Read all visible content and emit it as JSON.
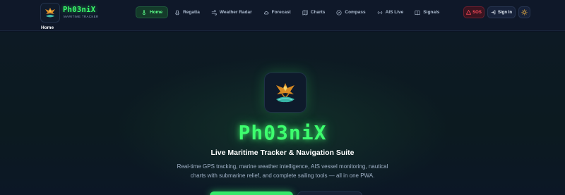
{
  "brand": {
    "name": "Ph03niX",
    "tagline": "MARITIME TRACKER"
  },
  "nav": {
    "items": [
      {
        "label": "Home",
        "icon": "anchor-icon",
        "active": true
      },
      {
        "label": "Regatta",
        "icon": "boat-icon",
        "active": false
      },
      {
        "label": "Weather Radar",
        "icon": "wind-icon",
        "active": false
      },
      {
        "label": "Forecast",
        "icon": "cloud-icon",
        "active": false
      },
      {
        "label": "Charts",
        "icon": "map-icon",
        "active": false
      },
      {
        "label": "Compass",
        "icon": "compass-icon",
        "active": false
      },
      {
        "label": "AIS Live",
        "icon": "radio-icon",
        "active": false
      },
      {
        "label": "Signals",
        "icon": "book-icon",
        "active": false
      }
    ]
  },
  "actions": {
    "sos_label": "SOS",
    "signin_label": "Sign In",
    "theme_icon": "sun-icon"
  },
  "breadcrumb": {
    "current": "Home"
  },
  "hero": {
    "title": "Ph03niX",
    "subtitle": "Live Maritime Tracker & Navigation Suite",
    "description": "Real-time GPS tracking, marine weather intelligence, AIS vessel monitoring, nautical charts with submarine relief, and complete sailing tools — all in one PWA."
  },
  "colors": {
    "accent": "#39ff6a",
    "background": "#0c1424",
    "sos": "#ff4a5a"
  }
}
